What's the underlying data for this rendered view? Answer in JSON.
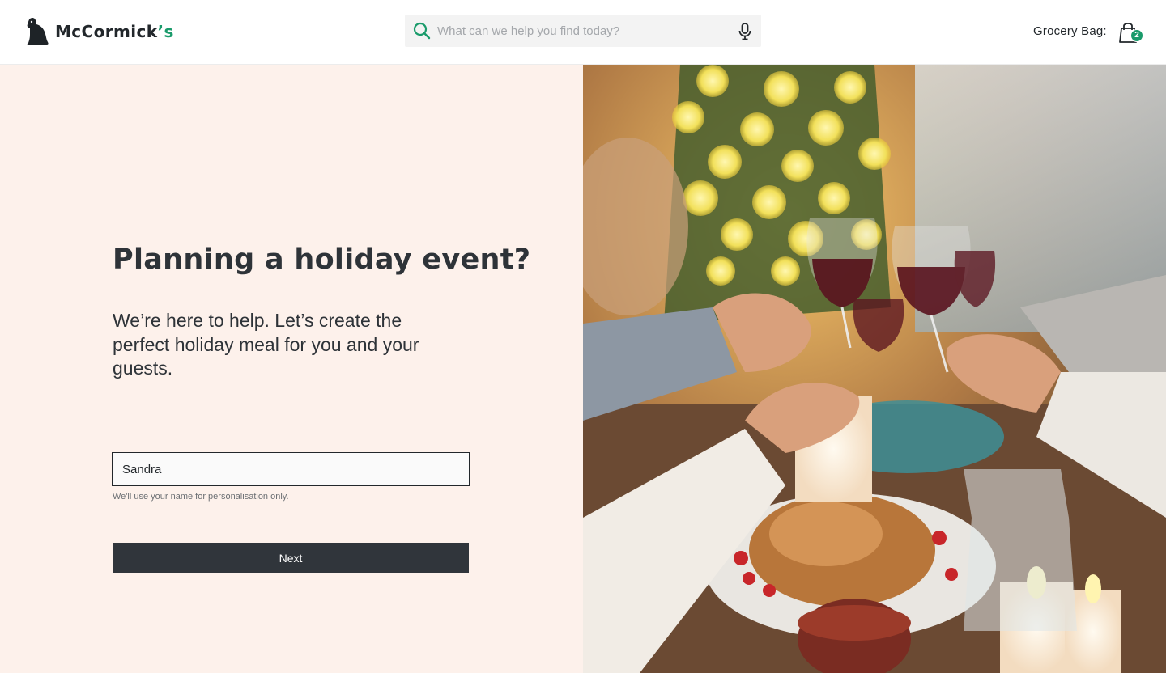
{
  "header": {
    "brand": {
      "name": "McCormick",
      "apostrophe_s": "’s",
      "accent": "#1a9b6b"
    },
    "search": {
      "placeholder": "What can we help you find today?",
      "value": ""
    },
    "bag": {
      "label": "Grocery Bag:",
      "count": "2"
    }
  },
  "main": {
    "headline": "Planning a holiday event?",
    "subheadline": "We’re here to help. Let’s create the perfect holiday meal for you and your guests.",
    "name_field": {
      "value": "Sandra",
      "hint": "We'll use your name for personalisation only."
    },
    "next_label": "Next"
  },
  "colors": {
    "panel_background": "#fdf1eb",
    "button_background": "#30353b",
    "accent": "#1a9b6b",
    "text": "#2e3338"
  },
  "icons": [
    "dog-logo-icon",
    "search-icon",
    "microphone-icon",
    "shopping-bag-icon"
  ]
}
